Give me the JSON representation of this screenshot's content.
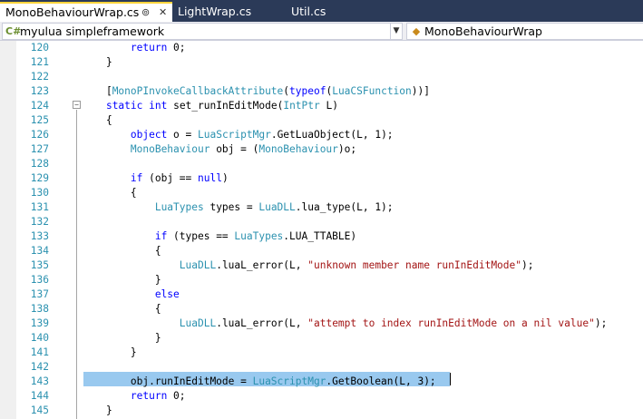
{
  "tabs": [
    {
      "label": "MonoBehaviourWrap.cs",
      "active": true
    },
    {
      "label": "LightWrap.cs",
      "active": false
    },
    {
      "label": "Util.cs",
      "active": false
    }
  ],
  "tab_icons": {
    "pin": "pin-icon",
    "close": "close-icon"
  },
  "navbar": {
    "project": "myulua simpleframework",
    "member": "MonoBehaviourWrap",
    "project_icon": "csharp-project-icon",
    "member_icon": "class-icon"
  },
  "colors": {
    "keyword": "#0000ff",
    "type": "#2b91af",
    "string": "#a31515",
    "line_number": "#2b91af",
    "selection": "#99c9ef",
    "tab_strip": "#2b3a58",
    "active_tab_marker": "#ffd43b"
  },
  "editor": {
    "highlighted_line": "143",
    "lines": [
      {
        "n": "120",
        "tokens": [
          {
            "t": "        "
          },
          {
            "t": "return",
            "c": "kw"
          },
          {
            "t": " 0;"
          }
        ]
      },
      {
        "n": "121",
        "tokens": [
          {
            "t": "    }"
          }
        ]
      },
      {
        "n": "122",
        "tokens": []
      },
      {
        "n": "123",
        "tokens": [
          {
            "t": "    ["
          },
          {
            "t": "MonoPInvokeCallbackAttribute",
            "c": "ty"
          },
          {
            "t": "("
          },
          {
            "t": "typeof",
            "c": "kw"
          },
          {
            "t": "("
          },
          {
            "t": "LuaCSFunction",
            "c": "ty"
          },
          {
            "t": "))]"
          }
        ]
      },
      {
        "n": "124",
        "tokens": [
          {
            "t": "    "
          },
          {
            "t": "static",
            "c": "kw"
          },
          {
            "t": " "
          },
          {
            "t": "int",
            "c": "kw"
          },
          {
            "t": " set_runInEditMode("
          },
          {
            "t": "IntPtr",
            "c": "ty"
          },
          {
            "t": " L)"
          }
        ]
      },
      {
        "n": "125",
        "tokens": [
          {
            "t": "    {"
          }
        ]
      },
      {
        "n": "126",
        "tokens": [
          {
            "t": "        "
          },
          {
            "t": "object",
            "c": "kw"
          },
          {
            "t": " o = "
          },
          {
            "t": "LuaScriptMgr",
            "c": "ty"
          },
          {
            "t": ".GetLuaObject(L, 1);"
          }
        ]
      },
      {
        "n": "127",
        "tokens": [
          {
            "t": "        "
          },
          {
            "t": "MonoBehaviour",
            "c": "ty"
          },
          {
            "t": " obj = ("
          },
          {
            "t": "MonoBehaviour",
            "c": "ty"
          },
          {
            "t": ")o;"
          }
        ]
      },
      {
        "n": "128",
        "tokens": []
      },
      {
        "n": "129",
        "tokens": [
          {
            "t": "        "
          },
          {
            "t": "if",
            "c": "kw"
          },
          {
            "t": " (obj == "
          },
          {
            "t": "null",
            "c": "kw"
          },
          {
            "t": ")"
          }
        ]
      },
      {
        "n": "130",
        "tokens": [
          {
            "t": "        {"
          }
        ]
      },
      {
        "n": "131",
        "tokens": [
          {
            "t": "            "
          },
          {
            "t": "LuaTypes",
            "c": "ty"
          },
          {
            "t": " types = "
          },
          {
            "t": "LuaDLL",
            "c": "ty"
          },
          {
            "t": ".lua_type(L, 1);"
          }
        ]
      },
      {
        "n": "132",
        "tokens": []
      },
      {
        "n": "133",
        "tokens": [
          {
            "t": "            "
          },
          {
            "t": "if",
            "c": "kw"
          },
          {
            "t": " (types == "
          },
          {
            "t": "LuaTypes",
            "c": "ty"
          },
          {
            "t": ".LUA_TTABLE)"
          }
        ]
      },
      {
        "n": "134",
        "tokens": [
          {
            "t": "            {"
          }
        ]
      },
      {
        "n": "135",
        "tokens": [
          {
            "t": "                "
          },
          {
            "t": "LuaDLL",
            "c": "ty"
          },
          {
            "t": ".luaL_error(L, "
          },
          {
            "t": "\"unknown member name runInEditMode\"",
            "c": "st"
          },
          {
            "t": ");"
          }
        ]
      },
      {
        "n": "136",
        "tokens": [
          {
            "t": "            }"
          }
        ]
      },
      {
        "n": "137",
        "tokens": [
          {
            "t": "            "
          },
          {
            "t": "else",
            "c": "kw"
          }
        ]
      },
      {
        "n": "138",
        "tokens": [
          {
            "t": "            {"
          }
        ]
      },
      {
        "n": "139",
        "tokens": [
          {
            "t": "                "
          },
          {
            "t": "LuaDLL",
            "c": "ty"
          },
          {
            "t": ".luaL_error(L, "
          },
          {
            "t": "\"attempt to index runInEditMode on a nil value\"",
            "c": "st"
          },
          {
            "t": ");"
          }
        ]
      },
      {
        "n": "140",
        "tokens": [
          {
            "t": "            }"
          }
        ]
      },
      {
        "n": "141",
        "tokens": [
          {
            "t": "        }"
          }
        ]
      },
      {
        "n": "142",
        "tokens": []
      },
      {
        "n": "143",
        "tokens": [
          {
            "t": "        obj.runInEditMode = "
          },
          {
            "t": "LuaScriptMgr",
            "c": "ty"
          },
          {
            "t": ".GetBoolean(L, 3);"
          }
        ]
      },
      {
        "n": "144",
        "tokens": [
          {
            "t": "        "
          },
          {
            "t": "return",
            "c": "kw"
          },
          {
            "t": " 0;"
          }
        ]
      },
      {
        "n": "145",
        "tokens": [
          {
            "t": "    }"
          }
        ]
      }
    ]
  }
}
